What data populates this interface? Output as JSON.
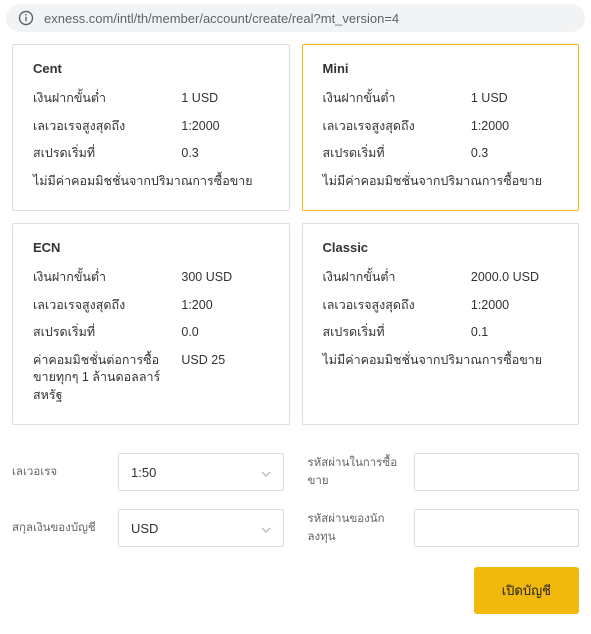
{
  "url": "exness.com/intl/th/member/account/create/real?mt_version=4",
  "cards": [
    {
      "title": "Cent",
      "selected": false,
      "rows": [
        {
          "label": "เงินฝากขั้นต่ำ",
          "value": "1 USD"
        },
        {
          "label": "เลเวอเรจสูงสุดถึง",
          "value": "1:2000"
        },
        {
          "label": "สเปรดเริ่มที่",
          "value": "0.3"
        },
        {
          "label": "ไม่มีค่าคอมมิชชั่นจากปริมาณการซื้อขาย",
          "value": ""
        }
      ]
    },
    {
      "title": "Mini",
      "selected": true,
      "rows": [
        {
          "label": "เงินฝากขั้นต่ำ",
          "value": "1 USD"
        },
        {
          "label": "เลเวอเรจสูงสุดถึง",
          "value": "1:2000"
        },
        {
          "label": "สเปรดเริ่มที่",
          "value": "0.3"
        },
        {
          "label": "ไม่มีค่าคอมมิชชั่นจากปริมาณการซื้อขาย",
          "value": ""
        }
      ]
    },
    {
      "title": "ECN",
      "selected": false,
      "rows": [
        {
          "label": "เงินฝากขั้นต่ำ",
          "value": "300 USD"
        },
        {
          "label": "เลเวอเรจสูงสุดถึง",
          "value": "1:200"
        },
        {
          "label": "สเปรดเริ่มที่",
          "value": "0.0"
        },
        {
          "label": "ค่าคอมมิชชั่นต่อการซื้อขายทุกๆ 1 ล้านดอลลาร์สหรัฐ",
          "value": "USD 25"
        }
      ]
    },
    {
      "title": "Classic",
      "selected": false,
      "rows": [
        {
          "label": "เงินฝากขั้นต่ำ",
          "value": "2000.0 USD"
        },
        {
          "label": "เลเวอเรจสูงสุดถึง",
          "value": "1:2000"
        },
        {
          "label": "สเปรดเริ่มที่",
          "value": "0.1"
        },
        {
          "label": "ไม่มีค่าคอมมิชชั่นจากปริมาณการซื้อขาย",
          "value": ""
        }
      ]
    }
  ],
  "form": {
    "leverage_label": "เลเวอเรจ",
    "leverage_value": "1:50",
    "currency_label": "สกุลเงินของบัญชี",
    "currency_value": "USD",
    "trading_password_label": "รหัสผ่านในการซื้อขาย",
    "investor_password_label": "รหัสผ่านของนักลงทุน"
  },
  "button": "เปิดบัญชี"
}
